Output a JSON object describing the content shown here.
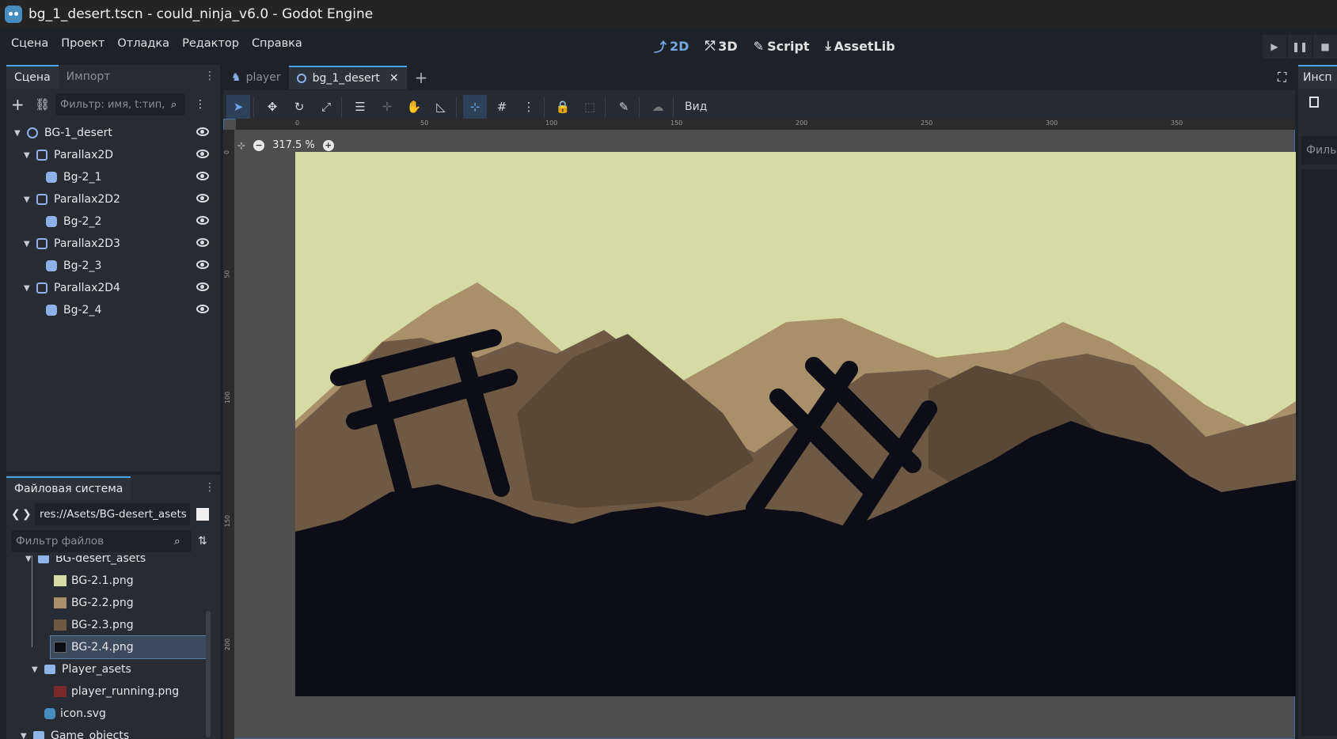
{
  "window": {
    "title": "bg_1_desert.tscn - could_ninja_v6.0 - Godot Engine"
  },
  "menu": [
    "Сцена",
    "Проект",
    "Отладка",
    "Редактор",
    "Справка"
  ],
  "workspaces": [
    {
      "label": "2D",
      "icon": "2d-icon",
      "active": true
    },
    {
      "label": "3D",
      "icon": "3d-icon",
      "active": false
    },
    {
      "label": "Script",
      "icon": "script-icon",
      "active": false
    },
    {
      "label": "AssetLib",
      "icon": "assetlib-icon",
      "active": false
    }
  ],
  "scene_dock": {
    "tabs": [
      "Сцена",
      "Импорт"
    ],
    "filter_placeholder": "Фильтр: имя, t:тип, g",
    "tree": [
      {
        "label": "BG-1_desert",
        "type": "node",
        "depth": 0
      },
      {
        "label": "Parallax2D",
        "type": "parallax",
        "depth": 1
      },
      {
        "label": "Bg-2_1",
        "type": "sprite",
        "depth": 2
      },
      {
        "label": "Parallax2D2",
        "type": "parallax",
        "depth": 1
      },
      {
        "label": "Bg-2_2",
        "type": "sprite",
        "depth": 2
      },
      {
        "label": "Parallax2D3",
        "type": "parallax",
        "depth": 1
      },
      {
        "label": "Bg-2_3",
        "type": "sprite",
        "depth": 2
      },
      {
        "label": "Parallax2D4",
        "type": "parallax",
        "depth": 1
      },
      {
        "label": "Bg-2_4",
        "type": "sprite",
        "depth": 2
      }
    ]
  },
  "fs_dock": {
    "tab": "Файловая система",
    "path": "res://Asets/BG-desert_asets",
    "filter_placeholder": "Фильтр файлов",
    "items": [
      {
        "label": "BG-desert_asets",
        "kind": "folder",
        "depth": 1
      },
      {
        "label": "BG-2.1.png",
        "kind": "image",
        "thumb": "#d6dba4",
        "depth": 2
      },
      {
        "label": "BG-2.2.png",
        "kind": "image",
        "thumb": "#a8906a",
        "depth": 2
      },
      {
        "label": "BG-2.3.png",
        "kind": "image",
        "thumb": "#6e5a44",
        "depth": 2
      },
      {
        "label": "BG-2.4.png",
        "kind": "image",
        "thumb": "#0c0d16",
        "depth": 2,
        "selected": true
      },
      {
        "label": "Player_asets",
        "kind": "folder",
        "depth": 1
      },
      {
        "label": "player_running.png",
        "kind": "image",
        "thumb": "#7a2a2a",
        "depth": 2
      },
      {
        "label": "icon.svg",
        "kind": "icon",
        "thumb": "#478cbf",
        "depth": 1
      },
      {
        "label": "Game_objects",
        "kind": "folder",
        "depth": 0
      }
    ]
  },
  "editor_tabs": [
    {
      "label": "player",
      "active": false
    },
    {
      "label": "bg_1_desert",
      "active": true
    }
  ],
  "toolbar": {
    "view_label": "Вид"
  },
  "viewport": {
    "zoom": "317.5 %",
    "ruler_h": [
      "0",
      "50",
      "100",
      "150",
      "200",
      "250",
      "300",
      "350"
    ],
    "ruler_v": [
      "0",
      "50",
      "100",
      "150",
      "200"
    ]
  },
  "inspector": {
    "tab": "Инсп",
    "filter": "Филь"
  },
  "colors": {
    "sky": "#d6dba4",
    "far": "#a8906a",
    "mid": "#6e5a44",
    "near": "#0c0d16",
    "accent": "#4aa3ea"
  }
}
